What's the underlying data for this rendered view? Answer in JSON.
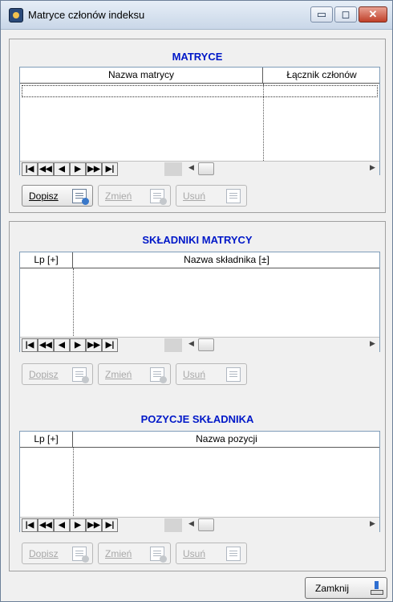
{
  "window": {
    "title": "Matryce członów indeksu",
    "controls": {
      "minimize": "▭",
      "maximize": "◻",
      "close": "✕"
    }
  },
  "nav_buttons": [
    "|◀",
    "◀◀",
    "◀",
    "▶",
    "▶▶",
    "▶|"
  ],
  "scrollbar": {
    "left_arrow": "◀",
    "right_arrow": "▶"
  },
  "matrices": {
    "title": "MATRYCE",
    "columns": [
      "Nazwa matrycy",
      "Łącznik członów"
    ],
    "buttons": {
      "add": "Dopisz",
      "edit": "Zmień",
      "delete": "Usuń"
    }
  },
  "components": {
    "title": "SKŁADNIKI MATRYCY",
    "columns": [
      "Lp [+]",
      "Nazwa składnika [±]"
    ],
    "buttons": {
      "add": "Dopisz",
      "edit": "Zmień",
      "delete": "Usuń"
    }
  },
  "positions": {
    "title": "POZYCJE SKŁADNIKA",
    "columns": [
      "Lp [+]",
      "Nazwa pozycji"
    ],
    "buttons": {
      "add": "Dopisz",
      "edit": "Zmień",
      "delete": "Usuń"
    }
  },
  "footer": {
    "close_label": "Zamknij"
  }
}
